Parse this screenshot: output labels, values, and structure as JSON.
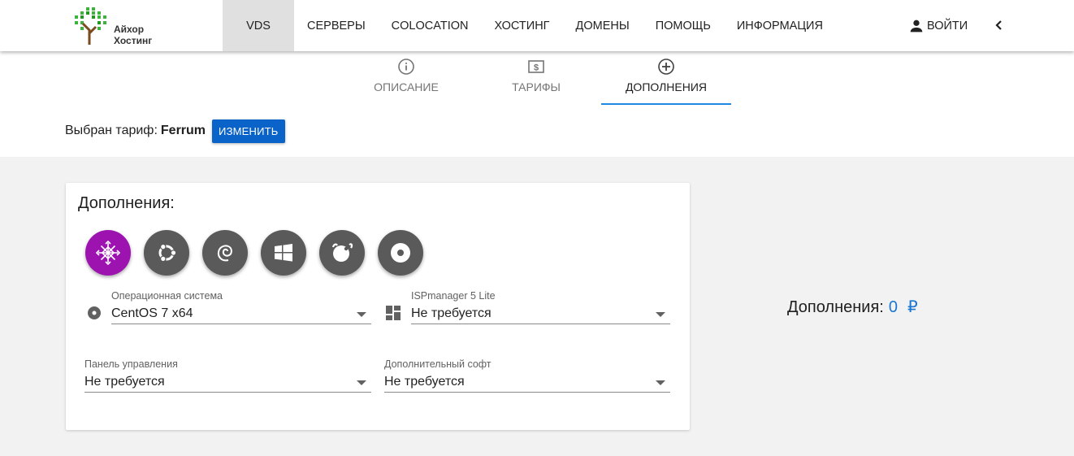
{
  "header": {
    "logo_line1": "Айхор",
    "logo_line2": "Хостинг",
    "nav": [
      "VDS",
      "СЕРВЕРЫ",
      "COLOCATION",
      "ХОСТИНГ",
      "ДОМЕНЫ",
      "ПОМОЩЬ",
      "ИНФОРМАЦИЯ"
    ],
    "active_nav": "VDS",
    "login_label": "ВОЙТИ"
  },
  "subtabs": [
    {
      "label": "ОПИСАНИЕ",
      "icon": "info-icon"
    },
    {
      "label": "ТАРИФЫ",
      "icon": "dollar-icon"
    },
    {
      "label": "ДОПОЛНЕНИЯ",
      "icon": "plus-circle-icon"
    }
  ],
  "active_subtab": "ДОПОЛНЕНИЯ",
  "tariff": {
    "prefix": "Выбран тариф:",
    "name": "Ferrum",
    "change_label": "ИЗМЕНИТЬ"
  },
  "addons": {
    "title": "Дополнения:",
    "os_buttons": [
      "centos-icon",
      "ubuntu-icon",
      "debian-icon",
      "windows-icon",
      "freebsd-icon",
      "other-os-icon"
    ],
    "selected_os": "centos-icon",
    "os_field": {
      "label": "Операционная система",
      "value": "CentOS 7 x64"
    },
    "isp_field": {
      "label": "ISPmanager 5 Lite",
      "value": "Не требуется"
    },
    "panel_field": {
      "label": "Панель управления",
      "value": "Не требуется"
    },
    "soft_field": {
      "label": "Дополнительный софт",
      "value": "Не требуется"
    }
  },
  "summary": {
    "label": "Дополнения:",
    "amount": "0",
    "currency": "₽"
  },
  "colors": {
    "accent_blue": "#0a63c9",
    "selected_os_purple": "#9c13b0",
    "tab_underline": "#1e88e5",
    "price_blue": "#1976d2"
  }
}
